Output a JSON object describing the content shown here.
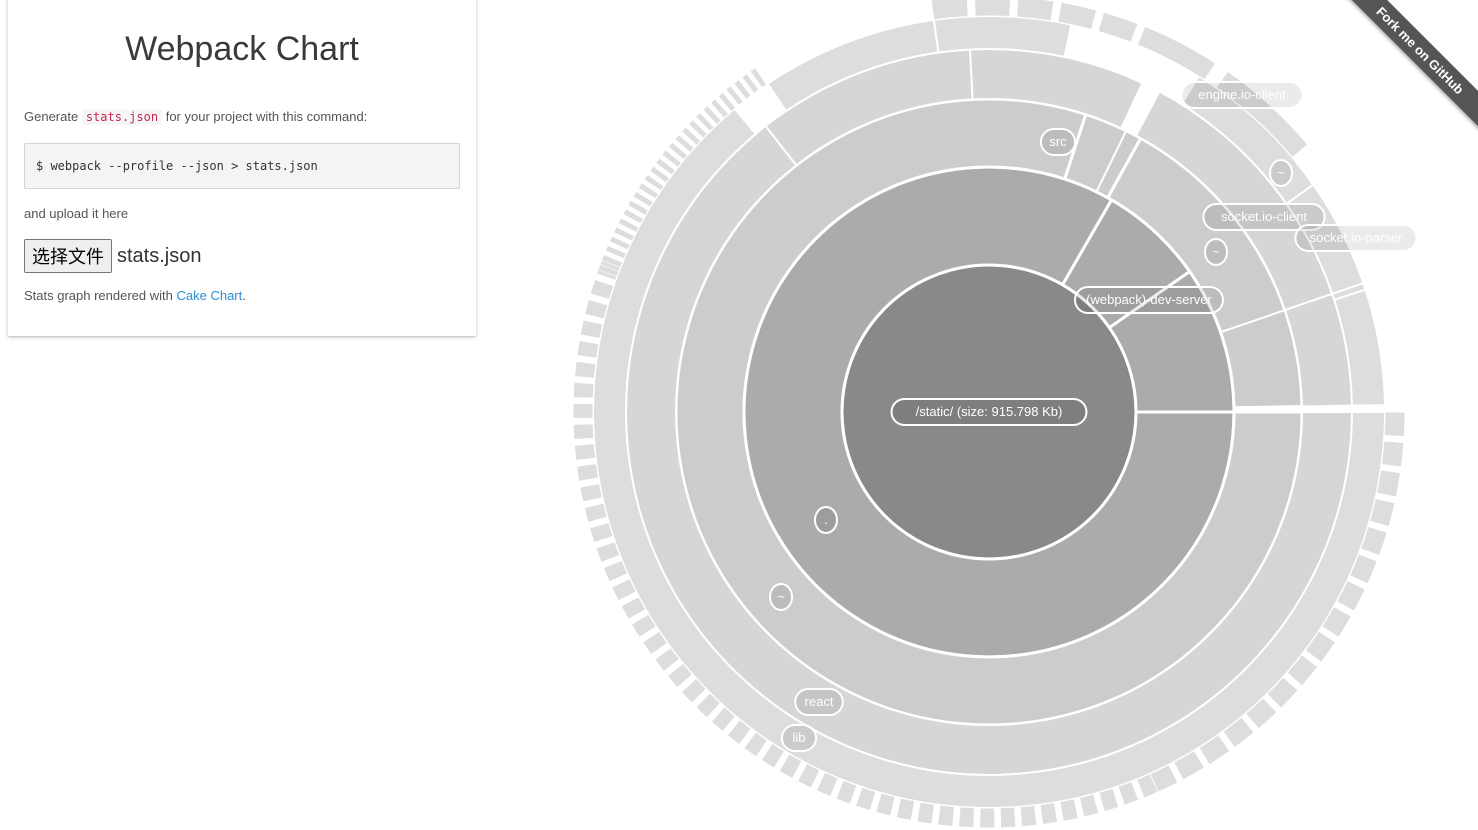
{
  "app": {
    "title": "Webpack Chart",
    "generate_prefix": "Generate",
    "stats_code": "stats.json",
    "generate_suffix": "for your project with this command:",
    "command": "$ webpack --profile --json > stats.json",
    "upload_text": "and upload it here",
    "file_button_label": "选择文件",
    "file_name": "stats.json",
    "footer_prefix": "Stats graph rendered with",
    "footer_link": "Cake Chart",
    "footer_suffix": "."
  },
  "ribbon": {
    "label": "Fork me on GitHub"
  },
  "colors": {
    "center": "#898989",
    "ring1": "#ababab",
    "ring2": "#cccccc",
    "ring3": "#d6d6d6",
    "outer": "#dddddd",
    "gap": "#ffffff"
  },
  "chart_data": {
    "type": "sunburst",
    "center_label": "/static/ (size: 915.798 Kb)",
    "labels": [
      "(webpack)-dev-server",
      "src",
      "engine.io-client",
      "~",
      "socket.io-client",
      "socket.io-parser",
      "~",
      ".",
      "~",
      "react",
      "lib"
    ]
  }
}
